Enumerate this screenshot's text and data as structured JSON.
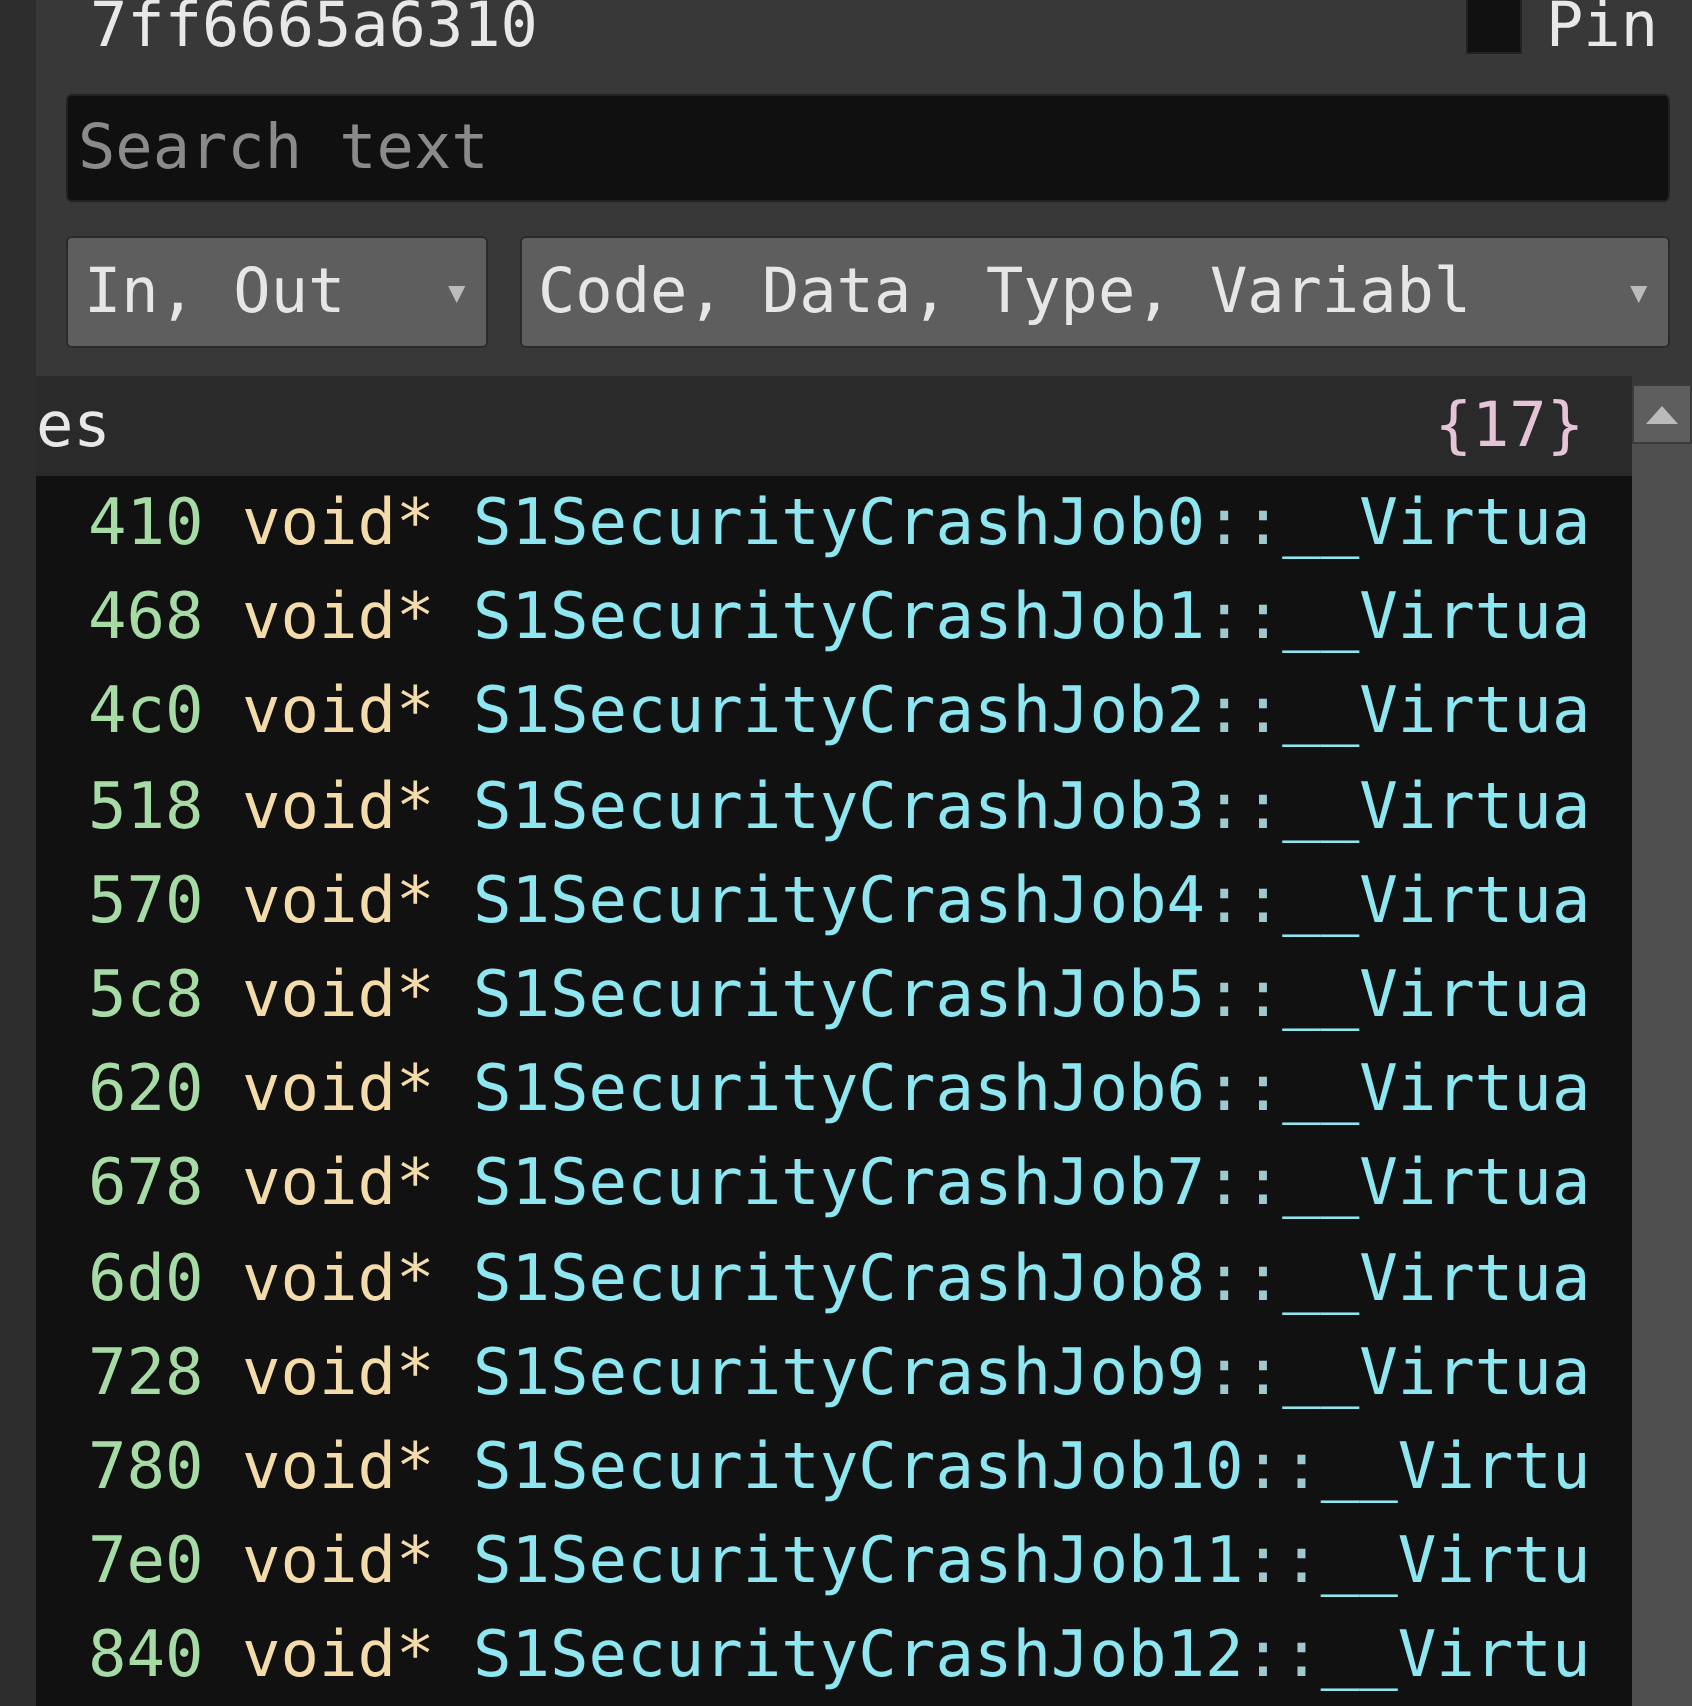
{
  "address": "7ff6665a6310",
  "pin": {
    "label": "Pin",
    "checked": false
  },
  "search": {
    "placeholder": "Search text"
  },
  "filters": [
    {
      "label": "In, Out",
      "caret": "▾"
    },
    {
      "label": "Code, Data, Type, Variabl",
      "caret": "▾"
    }
  ],
  "list": {
    "title": "es",
    "count": "{17}",
    "rows": [
      {
        "address": "410",
        "type": "void*",
        "name": "S1SecurityCrashJob0",
        "separator": "::",
        "member": "__Virtua"
      },
      {
        "address": "468",
        "type": "void*",
        "name": "S1SecurityCrashJob1",
        "separator": "::",
        "member": "__Virtua"
      },
      {
        "address": "4c0",
        "type": "void*",
        "name": "S1SecurityCrashJob2",
        "separator": "::",
        "member": "__Virtua"
      },
      {
        "address": "518",
        "type": "void*",
        "name": "S1SecurityCrashJob3",
        "separator": "::",
        "member": "__Virtua"
      },
      {
        "address": "570",
        "type": "void*",
        "name": "S1SecurityCrashJob4",
        "separator": "::",
        "member": "__Virtua"
      },
      {
        "address": "5c8",
        "type": "void*",
        "name": "S1SecurityCrashJob5",
        "separator": "::",
        "member": "__Virtua"
      },
      {
        "address": "620",
        "type": "void*",
        "name": "S1SecurityCrashJob6",
        "separator": "::",
        "member": "__Virtua"
      },
      {
        "address": "678",
        "type": "void*",
        "name": "S1SecurityCrashJob7",
        "separator": "::",
        "member": "__Virtua"
      },
      {
        "address": "6d0",
        "type": "void*",
        "name": "S1SecurityCrashJob8",
        "separator": "::",
        "member": "__Virtua"
      },
      {
        "address": "728",
        "type": "void*",
        "name": "S1SecurityCrashJob9",
        "separator": "::",
        "member": "__Virtua"
      },
      {
        "address": "780",
        "type": "void*",
        "name": "S1SecurityCrashJob10",
        "separator": "::",
        "member": "__Virtu"
      },
      {
        "address": "7e0",
        "type": "void*",
        "name": "S1SecurityCrashJob11",
        "separator": "::",
        "member": "__Virtu"
      },
      {
        "address": "840",
        "type": "void*",
        "name": "S1SecurityCrashJob12",
        "separator": "::",
        "member": "__Virtu"
      }
    ]
  }
}
